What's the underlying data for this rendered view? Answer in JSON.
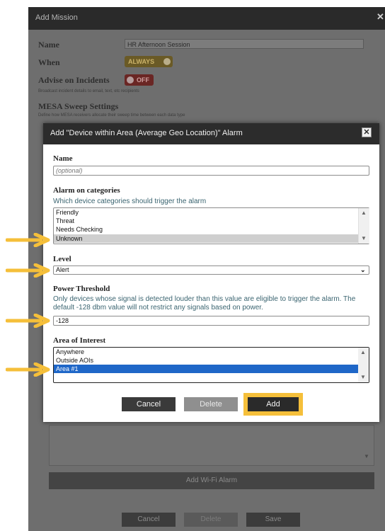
{
  "outer": {
    "title": "Add Mission",
    "close": "✕",
    "name_label": "Name",
    "name_value": "HR Afternoon Session",
    "when_label": "When",
    "when_value": "ALWAYS",
    "advise_label": "Advise on Incidents",
    "advise_value": "OFF",
    "advise_hint": "Broadcast incident details to email, text, etc recipients",
    "sweep_label": "MESA Sweep Settings",
    "sweep_hint": "Define how MESA receivers allocate their sweep time between each data type",
    "wifi_button": "Add Wi-Fi Alarm",
    "buttons": {
      "cancel": "Cancel",
      "delete": "Delete",
      "save": "Save"
    }
  },
  "modal": {
    "title": "Add \"Device within Area (Average Geo Location)\" Alarm",
    "close": "✕",
    "name": {
      "label": "Name",
      "placeholder": "(optional)"
    },
    "categories": {
      "label": "Alarm on categories",
      "hint": "Which device categories should trigger the alarm",
      "items": [
        "Friendly",
        "Threat",
        "Needs Checking",
        "Unknown"
      ],
      "selected": "Unknown"
    },
    "level": {
      "label": "Level",
      "value": "Alert"
    },
    "power": {
      "label": "Power Threshold",
      "description": "Only devices whose signal is detected louder than this value are eligible to trigger the alarm. The default -128 dbm value will not restrict any signals based on power.",
      "value": "-128"
    },
    "aoi": {
      "label": "Area of Interest",
      "items": [
        "Anywhere",
        "Outside AOIs",
        "Area #1"
      ],
      "selected": "Area #1"
    },
    "buttons": {
      "cancel": "Cancel",
      "delete": "Delete",
      "add": "Add"
    }
  },
  "icons": {
    "close": "close-icon",
    "scroll_up": "scroll-up-icon",
    "scroll_down": "scroll-down-icon",
    "chevron": "chevron-down-icon",
    "annotation": "arrow-right-icon"
  },
  "colors": {
    "highlight": "#f5bf3a",
    "selection_blue": "#1f67c8",
    "selection_gray": "#cfcfcf",
    "header_dark": "#2c2c2c",
    "hint_text": "#3a6470"
  }
}
